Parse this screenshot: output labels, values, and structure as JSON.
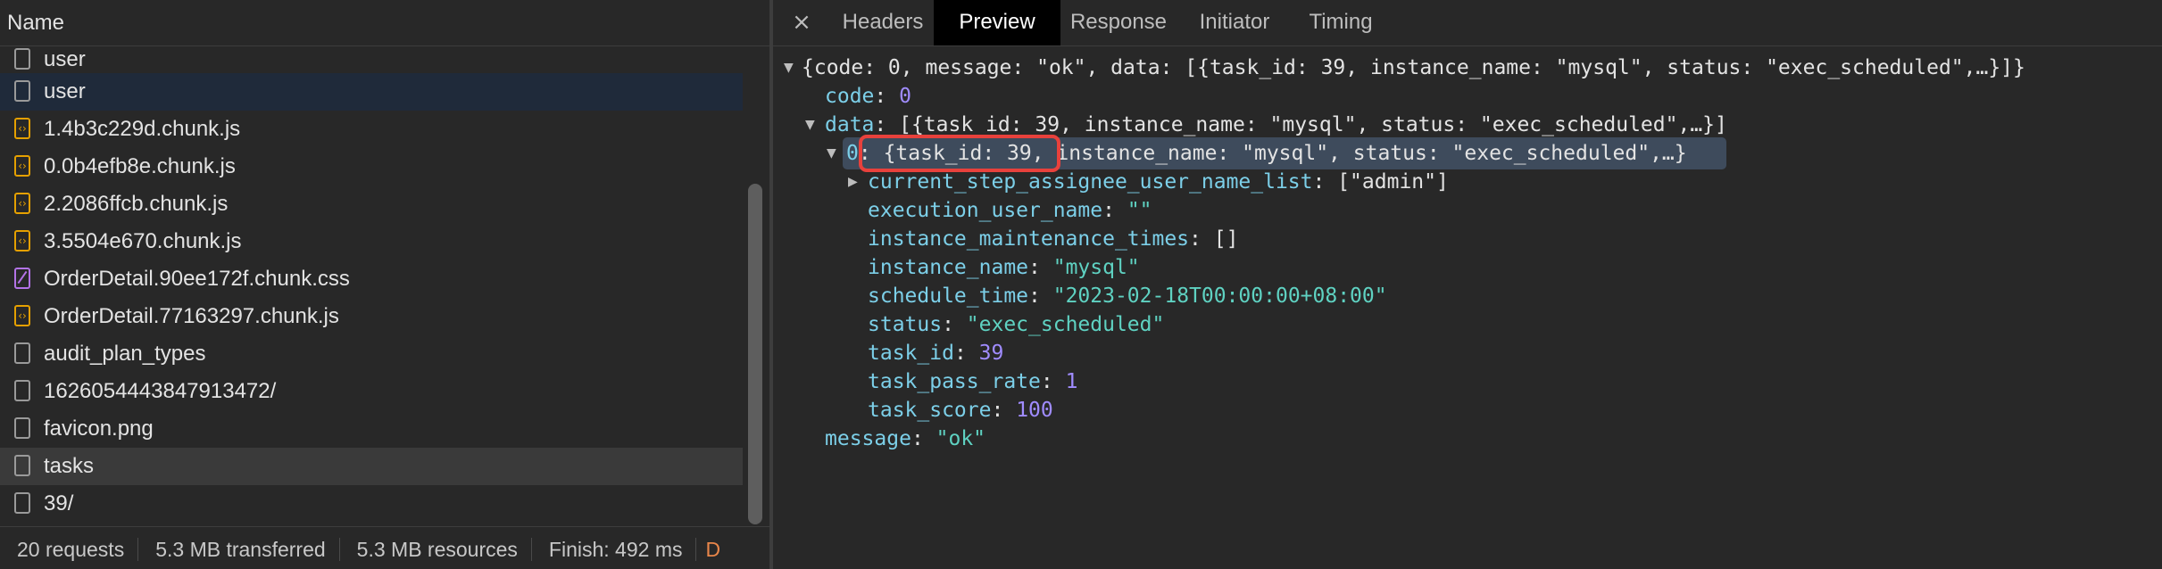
{
  "network": {
    "column_name": "Name",
    "requests": [
      {
        "name": "user",
        "type": "doc"
      },
      {
        "name": "user",
        "type": "doc"
      },
      {
        "name": "1.4b3c229d.chunk.js",
        "type": "js"
      },
      {
        "name": "0.0b4efb8e.chunk.js",
        "type": "js"
      },
      {
        "name": "2.2086ffcb.chunk.js",
        "type": "js"
      },
      {
        "name": "3.5504e670.chunk.js",
        "type": "js"
      },
      {
        "name": "OrderDetail.90ee172f.chunk.css",
        "type": "css"
      },
      {
        "name": "OrderDetail.77163297.chunk.js",
        "type": "js"
      },
      {
        "name": "audit_plan_types",
        "type": "doc"
      },
      {
        "name": "1626054443847913472/",
        "type": "doc"
      },
      {
        "name": "favicon.png",
        "type": "doc"
      },
      {
        "name": "tasks",
        "type": "doc"
      },
      {
        "name": "39/",
        "type": "doc"
      }
    ],
    "status": {
      "requests": "20 requests",
      "transferred": "5.3 MB transferred",
      "resources": "5.3 MB resources",
      "finish": "Finish: 492 ms",
      "dom": "D"
    }
  },
  "tabs": {
    "close_glyph": "×",
    "headers": "Headers",
    "preview": "Preview",
    "response": "Response",
    "initiator": "Initiator",
    "timing": "Timing"
  },
  "preview": {
    "root_summary": "{code: 0, message: \"ok\", data: [{task_id: 39, instance_name: \"mysql\", status: \"exec_scheduled\",…}]}",
    "code_key": "code",
    "code_value": "0",
    "data_key": "data",
    "data_summary": "[{task_id: 39, instance_name: \"mysql\", status: \"exec_scheduled\",…}]",
    "item_index": "0",
    "item_summary": "{task_id: 39, instance_name: \"mysql\", status: \"exec_scheduled\",…}",
    "fields": [
      {
        "key": "current_step_assignee_user_name_list",
        "value": "[\"admin\"]",
        "kind": "punc",
        "expandable": true
      },
      {
        "key": "execution_user_name",
        "value": "\"\"",
        "kind": "str",
        "expandable": false
      },
      {
        "key": "instance_maintenance_times",
        "value": "[]",
        "kind": "punc",
        "expandable": false
      },
      {
        "key": "instance_name",
        "value": "\"mysql\"",
        "kind": "str",
        "expandable": false
      },
      {
        "key": "schedule_time",
        "value": "\"2023-02-18T00:00:00+08:00\"",
        "kind": "str",
        "expandable": false
      },
      {
        "key": "status",
        "value": "\"exec_scheduled\"",
        "kind": "str",
        "expandable": false
      },
      {
        "key": "task_id",
        "value": "39",
        "kind": "num",
        "expandable": false
      },
      {
        "key": "task_pass_rate",
        "value": "1",
        "kind": "num",
        "expandable": false
      },
      {
        "key": "task_score",
        "value": "100",
        "kind": "num",
        "expandable": false
      }
    ],
    "message_key": "message",
    "message_value": "\"ok\""
  }
}
